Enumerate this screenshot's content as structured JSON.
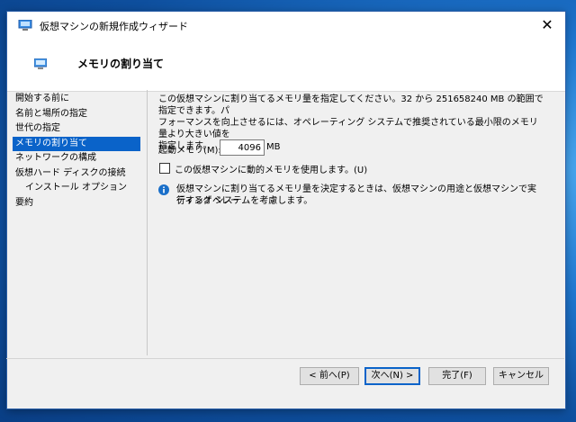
{
  "window": {
    "title": "仮想マシンの新規作成ウィザード",
    "close_glyph": "✕"
  },
  "header": {
    "title": "メモリの割り当て",
    "icon": "monitor-icon"
  },
  "nav": {
    "items": [
      {
        "label": "開始する前に",
        "active": false,
        "sub": false
      },
      {
        "label": "名前と場所の指定",
        "active": false,
        "sub": false
      },
      {
        "label": "世代の指定",
        "active": false,
        "sub": false
      },
      {
        "label": "メモリの割り当て",
        "active": true,
        "sub": false
      },
      {
        "label": "ネットワークの構成",
        "active": false,
        "sub": false
      },
      {
        "label": "仮想ハード ディスクの接続",
        "active": false,
        "sub": false
      },
      {
        "label": "インストール オプション",
        "active": false,
        "sub": true
      },
      {
        "label": "要約",
        "active": false,
        "sub": false
      }
    ]
  },
  "content": {
    "description_line1": "この仮想マシンに割り当てるメモリ量を指定してください。32 から 251658240 MB の範囲で指定できます。パ",
    "description_line2": "フォーマンスを向上させるには、オペレーティング システムで推奨されている最小限のメモリ量より大きい値を",
    "description_line3": "指定します。",
    "startup_memory_label": "起動メモリ(M):",
    "startup_memory_value": "4096",
    "startup_memory_unit": "MB",
    "dynamic_memory_label": "この仮想マシンに動的メモリを使用します。(U)",
    "dynamic_memory_checked": false,
    "info_line1": "仮想マシンに割り当てるメモリ量を決定するときは、仮想マシンの用途と仮想マシンで実行するオペレー",
    "info_line2": "ティング システムを考慮します。"
  },
  "buttons": {
    "back": "< 前へ(P)",
    "next": "次へ(N) >",
    "finish": "完了(F)",
    "cancel": "キャンセル"
  },
  "colors": {
    "accent": "#0a63c9",
    "info_icon": "#1a6fc9"
  }
}
